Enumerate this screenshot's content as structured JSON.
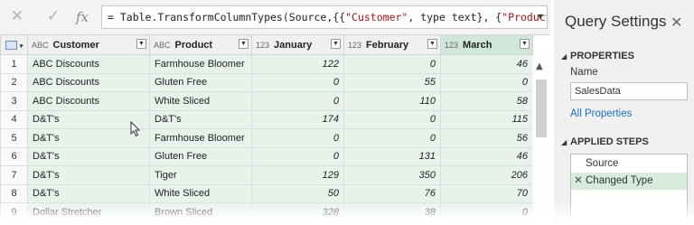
{
  "formula_bar": {
    "cancel_icon": "close-icon",
    "commit_icon": "check-icon",
    "fx_label": "fx",
    "formula_prefix": "= Table.TransformColumnTypes(Source,{{",
    "formula_str1": "\"Customer\"",
    "formula_mid": ", type text}, {",
    "formula_str2": "\"Product\"",
    "formula_suffix": ","
  },
  "grid": {
    "columns": [
      {
        "name": "Customer",
        "type_icon": "ABC"
      },
      {
        "name": "Product",
        "type_icon": "ABC"
      },
      {
        "name": "January",
        "type_icon": "123"
      },
      {
        "name": "February",
        "type_icon": "123"
      },
      {
        "name": "March",
        "type_icon": "123"
      }
    ],
    "rows": [
      {
        "n": "1",
        "customer": "ABC Discounts",
        "product": "Farmhouse Bloomer",
        "jan": "122",
        "feb": "0",
        "mar": "46"
      },
      {
        "n": "2",
        "customer": "ABC Discounts",
        "product": "Gluten Free",
        "jan": "0",
        "feb": "55",
        "mar": "0"
      },
      {
        "n": "3",
        "customer": "ABC Discounts",
        "product": "White Sliced",
        "jan": "0",
        "feb": "110",
        "mar": "58"
      },
      {
        "n": "4",
        "customer": "D&T's",
        "product": "D&T's",
        "jan": "174",
        "feb": "0",
        "mar": "115"
      },
      {
        "n": "5",
        "customer": "D&T's",
        "product": "Farmhouse Bloomer",
        "jan": "0",
        "feb": "0",
        "mar": "56"
      },
      {
        "n": "6",
        "customer": "D&T's",
        "product": "Gluten Free",
        "jan": "0",
        "feb": "131",
        "mar": "46"
      },
      {
        "n": "7",
        "customer": "D&T's",
        "product": "Tiger",
        "jan": "129",
        "feb": "350",
        "mar": "206"
      },
      {
        "n": "8",
        "customer": "D&T's",
        "product": "White Sliced",
        "jan": "50",
        "feb": "76",
        "mar": "70"
      },
      {
        "n": "9",
        "customer": "Dollar Stretcher",
        "product": "Brown Sliced",
        "jan": "328",
        "feb": "38",
        "mar": "0"
      }
    ]
  },
  "query_settings": {
    "title": "Query Settings",
    "close_glyph": "✕",
    "properties_heading": "PROPERTIES",
    "name_label": "Name",
    "name_value": "SalesData",
    "all_properties_link": "All Properties",
    "applied_steps_heading": "APPLIED STEPS",
    "steps": [
      {
        "label": "Source",
        "active": false
      },
      {
        "label": "Changed Type",
        "active": true
      }
    ]
  },
  "colors": {
    "selected_column_header": "#cfe6d8",
    "column_fill": "#e6f2ea",
    "active_step": "#d7ecdc",
    "link": "#1b6ec2"
  }
}
